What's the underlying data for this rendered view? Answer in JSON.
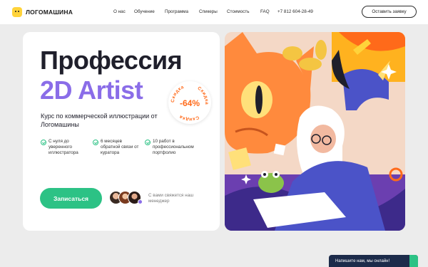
{
  "header": {
    "logo_text": "ЛОГОМАШИНА",
    "nav": [
      "О нас",
      "Обучение",
      "Программа",
      "Спикеры",
      "Стоимость",
      "FAQ",
      "+7 812 604-28-49"
    ],
    "cta_label": "Оставить заявку"
  },
  "hero": {
    "title_line1": "Профессия",
    "title_line2": "2D Artist",
    "subtitle": "Курс по коммерческой иллюстрации от Логомашины",
    "features": [
      "С нуля до уверенного иллюстратора",
      "6 месяцев обратной связи от куратора",
      "10 работ в профессиональном портфолио"
    ],
    "signup_label": "Записаться",
    "manager_text": "С вами свяжется наш менеджер"
  },
  "discount": {
    "percent": "-64%",
    "ring_word": "Скидка"
  },
  "chat": {
    "label": "Напишите нам, мы онлайн!"
  },
  "colors": {
    "accent_green": "#2cc285",
    "accent_purple": "#8a6de8",
    "discount_orange": "#ff6a1a",
    "chat_navy": "#1c2b4a"
  }
}
